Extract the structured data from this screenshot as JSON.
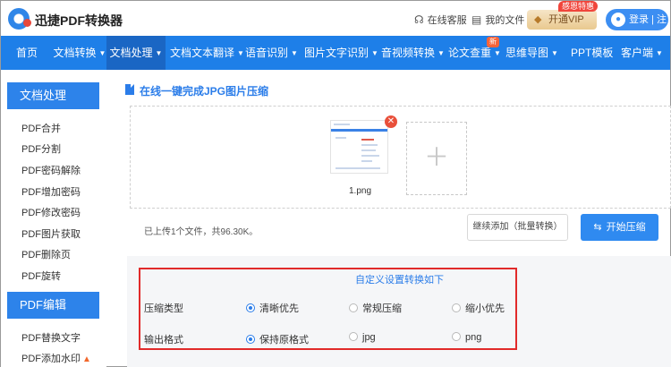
{
  "header": {
    "brand": "迅捷PDF转换器",
    "service_label": "在线客服",
    "files_label": "我的文件",
    "vip_label": "开通VIP",
    "vip_tag": "感恩特惠",
    "login_label": "登录 | 注册"
  },
  "nav": {
    "items": [
      {
        "label": "首页"
      },
      {
        "label": "文档转换"
      },
      {
        "label": "文档处理"
      },
      {
        "label": "文档文本翻译"
      },
      {
        "label": "语音识别"
      },
      {
        "label": "图片文字识别"
      },
      {
        "label": "音视频转换"
      },
      {
        "label": "论文查重"
      },
      {
        "label": "思维导图"
      },
      {
        "label": "PPT模板"
      },
      {
        "label": "客户端"
      }
    ],
    "new_badge": "新",
    "active_index": 2
  },
  "sidebar": {
    "section1_title": "文档处理",
    "section1_items": [
      "PDF合并",
      "PDF分割",
      "PDF密码解除",
      "PDF增加密码",
      "PDF修改密码",
      "PDF图片获取",
      "PDF删除页",
      "PDF旋转"
    ],
    "section2_title": "PDF编辑",
    "section2_items": [
      "PDF替换文字",
      "PDF添加水印"
    ]
  },
  "main": {
    "title": "在线一键完成JPG图片压缩",
    "file_name": "1.png",
    "status": "已上传1个文件，共96.30K。",
    "continue_label": "继续添加（批量转换）",
    "start_label": "开始压缩",
    "settings_title": "自定义设置转换如下",
    "compress_label": "压缩类型",
    "compress_options": [
      "清晰优先",
      "常规压缩",
      "缩小优先"
    ],
    "format_label": "输出格式",
    "format_options": [
      "保持原格式",
      "jpg",
      "png"
    ]
  },
  "colors": {
    "nav_bg": "#1e7fe8",
    "accent": "#2b7de9",
    "highlight_border": "#e12a2a"
  }
}
